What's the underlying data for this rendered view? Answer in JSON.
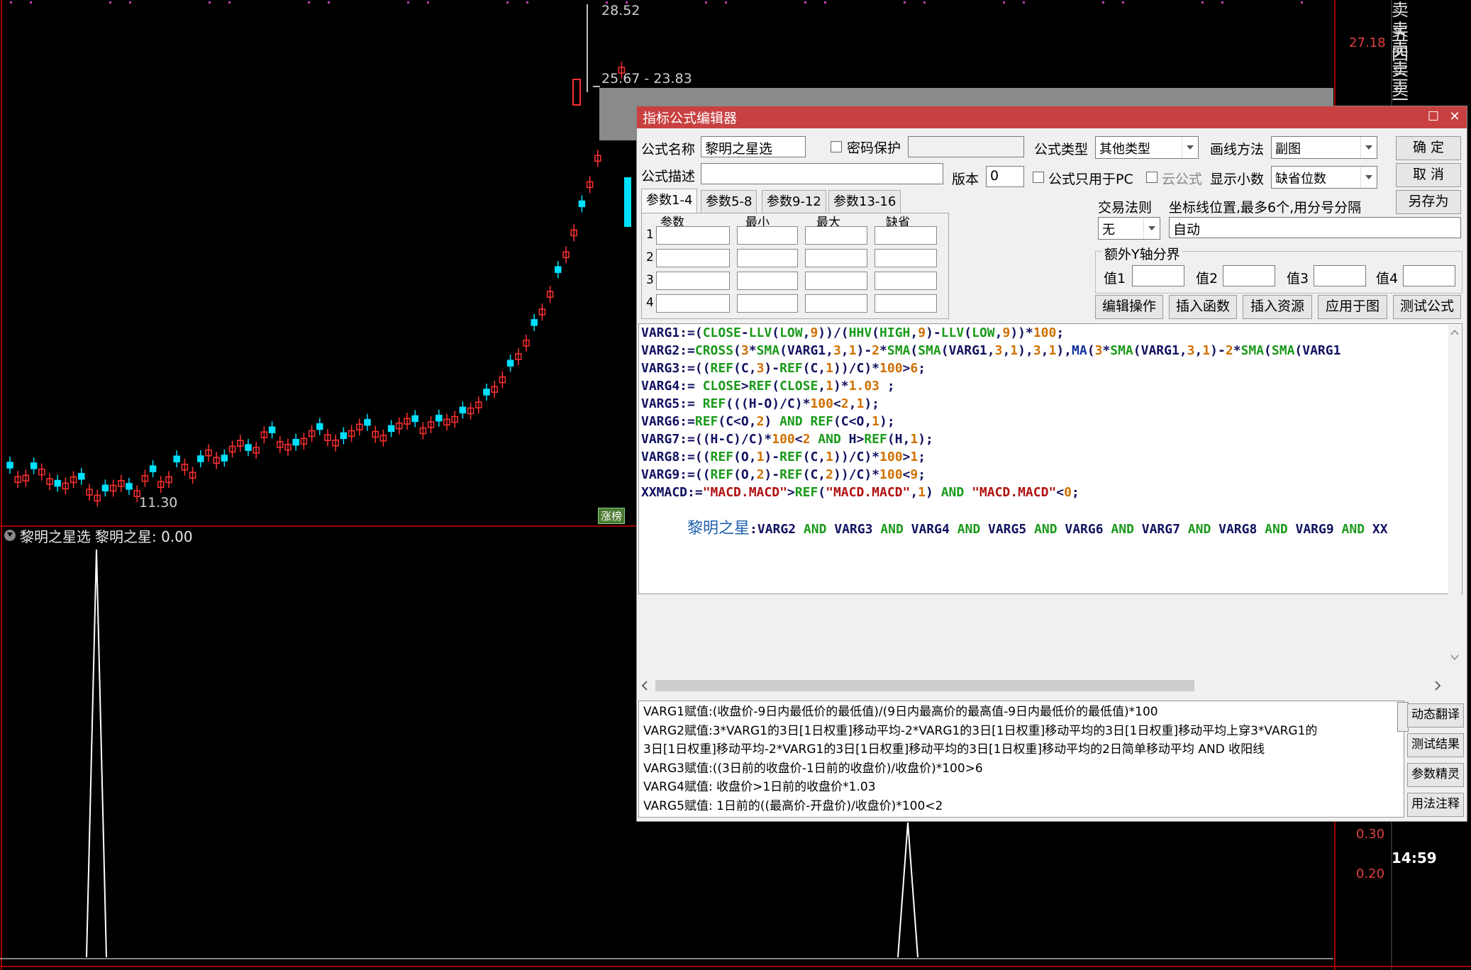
{
  "chart": {
    "price_high_label": "28.52",
    "price_range_label": "25.67 - 23.83",
    "price_low_label": "11.30",
    "axis_top_label": "27.18",
    "axis_label_1": "0.30",
    "axis_label_2": "0.20",
    "sell_levels": [
      "卖五",
      "卖四",
      "卖三",
      "卖二",
      "卖一"
    ],
    "rank_tag": "涨榜",
    "indicator_name": "黎明之星选",
    "indicator_value": "黎明之星: 0.00",
    "time": "14:59",
    "colors": {
      "up": "#ff3030",
      "down": "#00e0ff",
      "signal": "#ffffff",
      "grid": "#a00000"
    }
  },
  "dialog": {
    "title": "指标公式编辑器",
    "formula_name_label": "公式名称",
    "formula_name_value": "黎明之星选",
    "password_label": "密码保护",
    "formula_type_label": "公式类型",
    "formula_type_value": "其他类型",
    "draw_method_label": "画线方法",
    "draw_method_value": "副图",
    "ok_button": "确  定",
    "desc_label": "公式描述",
    "version_label": "版本",
    "version_value": "0",
    "pc_only_label": "公式只用于PC",
    "cloud_label": "云公式",
    "decimals_label": "显示小数",
    "decimals_value": "缺省位数",
    "cancel_button": "取  消",
    "save_as_button": "另存为",
    "tabs": [
      "参数1-4",
      "参数5-8",
      "参数9-12",
      "参数13-16"
    ],
    "param_headers": [
      "参数",
      "最小",
      "最大",
      "缺省"
    ],
    "param_rows": [
      "1",
      "2",
      "3",
      "4"
    ],
    "trade_rule_label": "交易法则",
    "trade_rule_value": "无",
    "axis_pos_label": "坐标线位置,最多6个,用分号分隔",
    "axis_pos_value": "自动",
    "extra_y_label": "额外Y轴分界",
    "val_labels": [
      "值1",
      "值2",
      "值3",
      "值4"
    ],
    "action_buttons": [
      "编辑操作",
      "插入函数",
      "插入资源",
      "应用于图",
      "测试公式"
    ],
    "code_lines": [
      "VARG1:=(CLOSE-LLV(LOW,9))/(HHV(HIGH,9)-LLV(LOW,9))*100;",
      "VARG2:=CROSS(3*SMA(VARG1,3,1)-2*SMA(SMA(VARG1,3,1),3,1),MA(3*SMA(VARG1,3,1)-2*SMA(SMA(VARG1",
      "VARG3:=((REF(C,3)-REF(C,1))/C)*100>6;",
      "VARG4:= CLOSE>REF(CLOSE,1)*1.03 ;",
      "VARG5:= REF(((H-O)/C)*100<2,1);",
      "VARG6:=REF(C<O,2) AND REF(C<O,1);",
      "VARG7:=((H-C)/C)*100<2 AND H>REF(H,1);",
      "VARG8:=((REF(O,1)-REF(C,1))/C)*100>1;",
      "VARG9:=((REF(O,2)-REF(C,2))/C)*100<9;",
      "XXMACD:=\"MACD.MACD\">REF(\"MACD.MACD\",1) AND \"MACD.MACD\"<0;"
    ],
    "last_line_name": "黎明之星",
    "last_line_rest": ":VARG2 AND VARG3 AND VARG4 AND VARG5 AND VARG6 AND VARG7 AND VARG8 AND VARG9 AND XX",
    "explain_lines": [
      "VARG1赋值:(收盘价-9日内最低价的最低值)/(9日内最高价的最高值-9日内最低价的最低值)*100",
      "VARG2赋值:3*VARG1的3日[1日权重]移动平均-2*VARG1的3日[1日权重]移动平均的3日[1日权重]移动平均上穿3*VARG1的",
      "3日[1日权重]移动平均-2*VARG1的3日[1日权重]移动平均的3日[1日权重]移动平均的2日简单移动平均 AND 收阳线",
      "VARG3赋值:((3日前的收盘价-1日前的收盘价)/收盘价)*100>6",
      "VARG4赋值: 收盘价>1日前的收盘价*1.03",
      "VARG5赋值: 1日前的((最高价-开盘价)/收盘价)*100<2"
    ],
    "side_buttons": [
      "动态翻译",
      "测试结果",
      "参数精灵",
      "用法注释"
    ]
  }
}
